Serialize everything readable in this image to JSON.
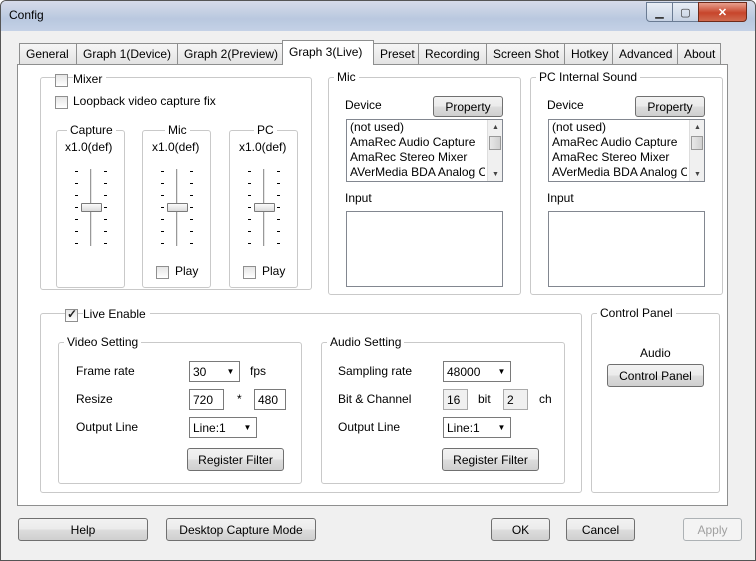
{
  "window": {
    "title": "Config"
  },
  "tabs": [
    "General",
    "Graph 1(Device)",
    "Graph 2(Preview)",
    "Graph 3(Live)",
    "Preset",
    "Recording",
    "Screen Shot",
    "Hotkey",
    "Advanced",
    "About"
  ],
  "active_tab": "Graph 3(Live)",
  "mixer_group": {
    "mixer_label": "Mixer",
    "mixer_checked": false,
    "loopback_label": "Loopback video capture fix",
    "loopback_checked": false,
    "capture": {
      "label": "Capture",
      "value": "x1.0(def)"
    },
    "mic": {
      "label": "Mic",
      "value": "x1.0(def)",
      "play_label": "Play",
      "play_checked": false
    },
    "pc": {
      "label": "PC",
      "value": "x1.0(def)",
      "play_label": "Play",
      "play_checked": false
    }
  },
  "mic_group": {
    "title": "Mic",
    "device_label": "Device",
    "property_button": "Property",
    "devices": [
      "(not used)",
      "AmaRec Audio Capture",
      "AmaRec Stereo Mixer",
      "AVerMedia BDA Analog C"
    ],
    "input_label": "Input"
  },
  "pc_group": {
    "title": "PC Internal Sound",
    "device_label": "Device",
    "property_button": "Property",
    "devices": [
      "(not used)",
      "AmaRec Audio Capture",
      "AmaRec Stereo Mixer",
      "AVerMedia BDA Analog C"
    ],
    "input_label": "Input"
  },
  "live": {
    "enable_label": "Live Enable",
    "enable_checked": true,
    "video": {
      "title": "Video Setting",
      "frame_rate_label": "Frame rate",
      "frame_rate_value": "30",
      "fps_label": "fps",
      "resize_label": "Resize",
      "width": "720",
      "times": "*",
      "height": "480",
      "output_line_label": "Output Line",
      "output_line_value": "Line:1",
      "register_filter": "Register Filter"
    },
    "audio": {
      "title": "Audio Setting",
      "sampling_rate_label": "Sampling rate",
      "sampling_rate_value": "48000",
      "bit_channel_label": "Bit & Channel",
      "bit_value": "16",
      "bit_label": "bit",
      "ch_value": "2",
      "ch_label": "ch",
      "output_line_label": "Output Line",
      "output_line_value": "Line:1",
      "register_filter": "Register Filter"
    }
  },
  "control_panel": {
    "title": "Control Panel",
    "audio_label": "Audio",
    "button": "Control Panel"
  },
  "footer": {
    "help": "Help",
    "desktop_capture": "Desktop Capture Mode",
    "ok": "OK",
    "cancel": "Cancel",
    "apply": "Apply"
  }
}
